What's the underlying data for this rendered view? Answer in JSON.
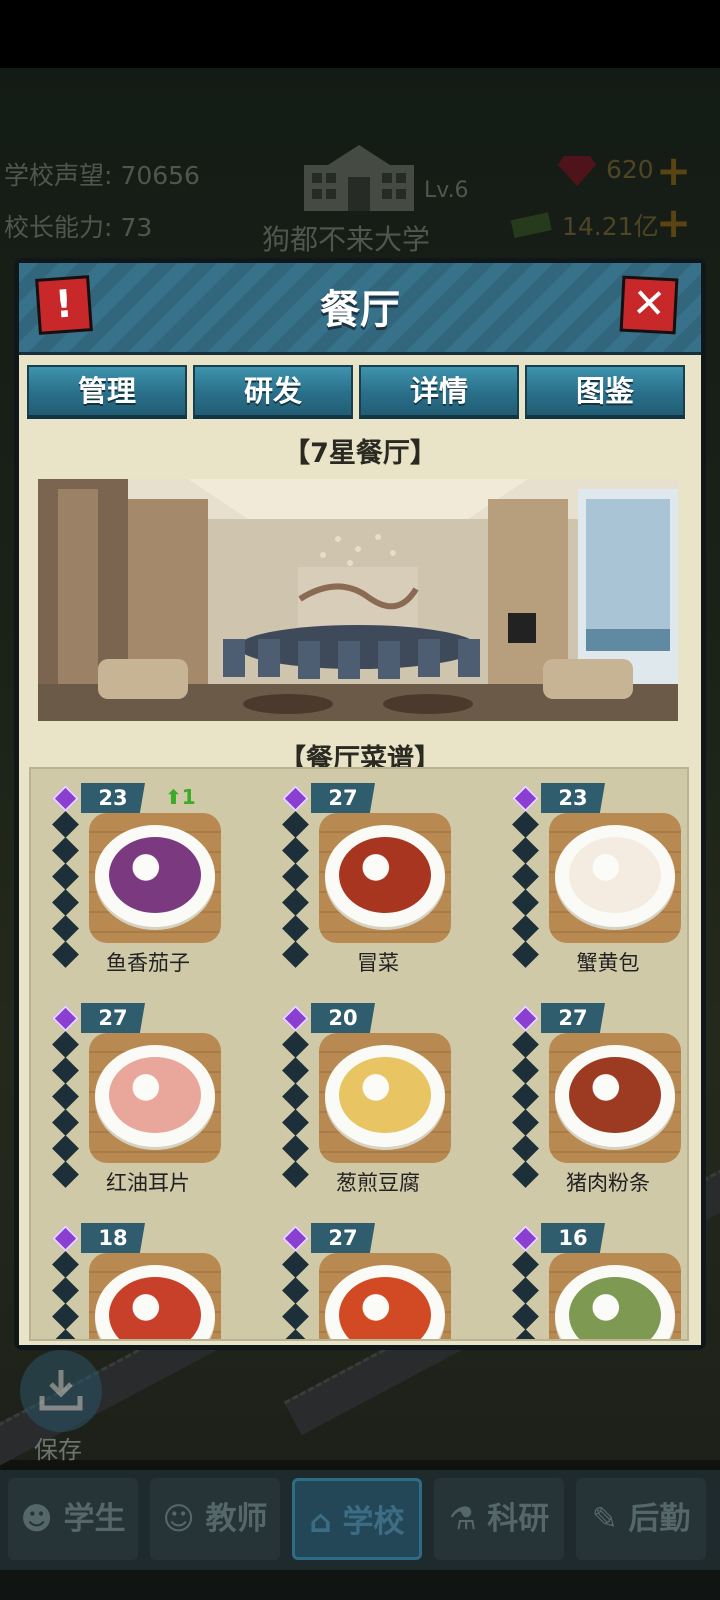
{
  "header": {
    "reputation_label": "学校声望:",
    "reputation_value": "70656",
    "ability_label": "校长能力:",
    "ability_value": "73",
    "school_name": "狗都不来大学",
    "school_level": "Lv.6",
    "gems": "620",
    "money": "14.21亿"
  },
  "panel": {
    "title": "餐厅",
    "alert_glyph": "!",
    "close_glyph": "✕",
    "tabs": [
      "管理",
      "研发",
      "详情",
      "图鉴"
    ],
    "restaurant_rank": "【7星餐厅】",
    "menu_title": "【餐厅菜谱】"
  },
  "dishes": [
    {
      "name": "鱼香茄子",
      "level": "23",
      "upgrade": "1",
      "stars_filled": 1,
      "food_color": "#7b3a7f"
    },
    {
      "name": "冒菜",
      "level": "27",
      "upgrade": "",
      "stars_filled": 1,
      "food_color": "#a8351f"
    },
    {
      "name": "蟹黄包",
      "level": "23",
      "upgrade": "",
      "stars_filled": 1,
      "food_color": "#f4ece0"
    },
    {
      "name": "红油耳片",
      "level": "27",
      "upgrade": "",
      "stars_filled": 1,
      "food_color": "#e8a79a"
    },
    {
      "name": "葱煎豆腐",
      "level": "20",
      "upgrade": "",
      "stars_filled": 1,
      "food_color": "#e9c463"
    },
    {
      "name": "猪肉粉条",
      "level": "27",
      "upgrade": "",
      "stars_filled": 1,
      "food_color": "#9c3b21"
    },
    {
      "name": "",
      "level": "18",
      "upgrade": "",
      "stars_filled": 1,
      "food_color": "#c8402a"
    },
    {
      "name": "",
      "level": "27",
      "upgrade": "",
      "stars_filled": 1,
      "food_color": "#d24a24"
    },
    {
      "name": "",
      "level": "16",
      "upgrade": "",
      "stars_filled": 1,
      "food_color": "#7e9a52"
    }
  ],
  "save_label": "保存",
  "nav": [
    "学生",
    "教师",
    "学校",
    "科研",
    "后勤"
  ],
  "nav_active": "学校",
  "colors": {
    "star_filled": "#8b3fd1",
    "star_empty": "#1d2f38",
    "tab": "#2a6f8a",
    "header": "#37718a"
  }
}
